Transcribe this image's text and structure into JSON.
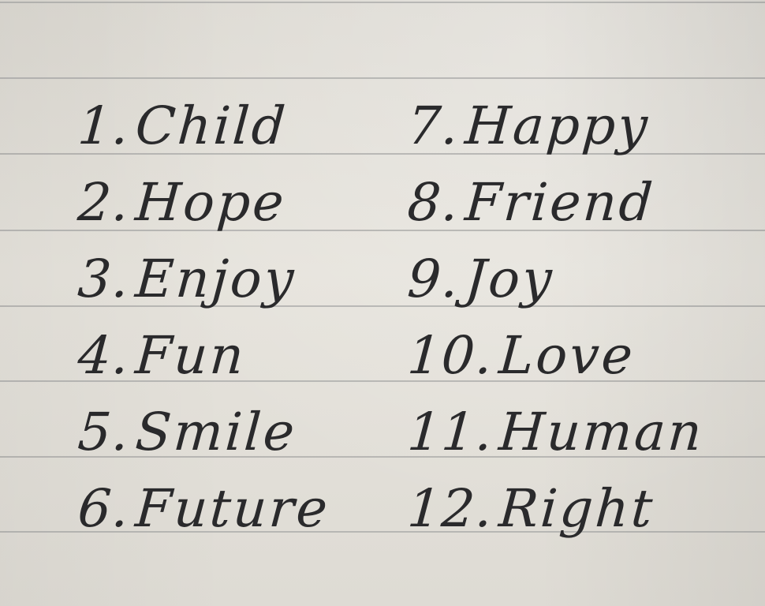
{
  "list": {
    "left": [
      {
        "num": "1.",
        "word": "Child"
      },
      {
        "num": "2.",
        "word": "Hope"
      },
      {
        "num": "3.",
        "word": "Enjoy"
      },
      {
        "num": "4.",
        "word": "Fun"
      },
      {
        "num": "5.",
        "word": "Smile"
      },
      {
        "num": "6.",
        "word": "Future"
      }
    ],
    "right": [
      {
        "num": "7.",
        "word": "Happy"
      },
      {
        "num": "8.",
        "word": "Friend"
      },
      {
        "num": "9.",
        "word": "Joy"
      },
      {
        "num": "10.",
        "word": "Love"
      },
      {
        "num": "11.",
        "word": "Human"
      },
      {
        "num": "12.",
        "word": "Right"
      }
    ]
  },
  "colors": {
    "paper": "#e2dfd8",
    "rule_line": "#a9aaa8",
    "ink": "#2a2a2c"
  }
}
